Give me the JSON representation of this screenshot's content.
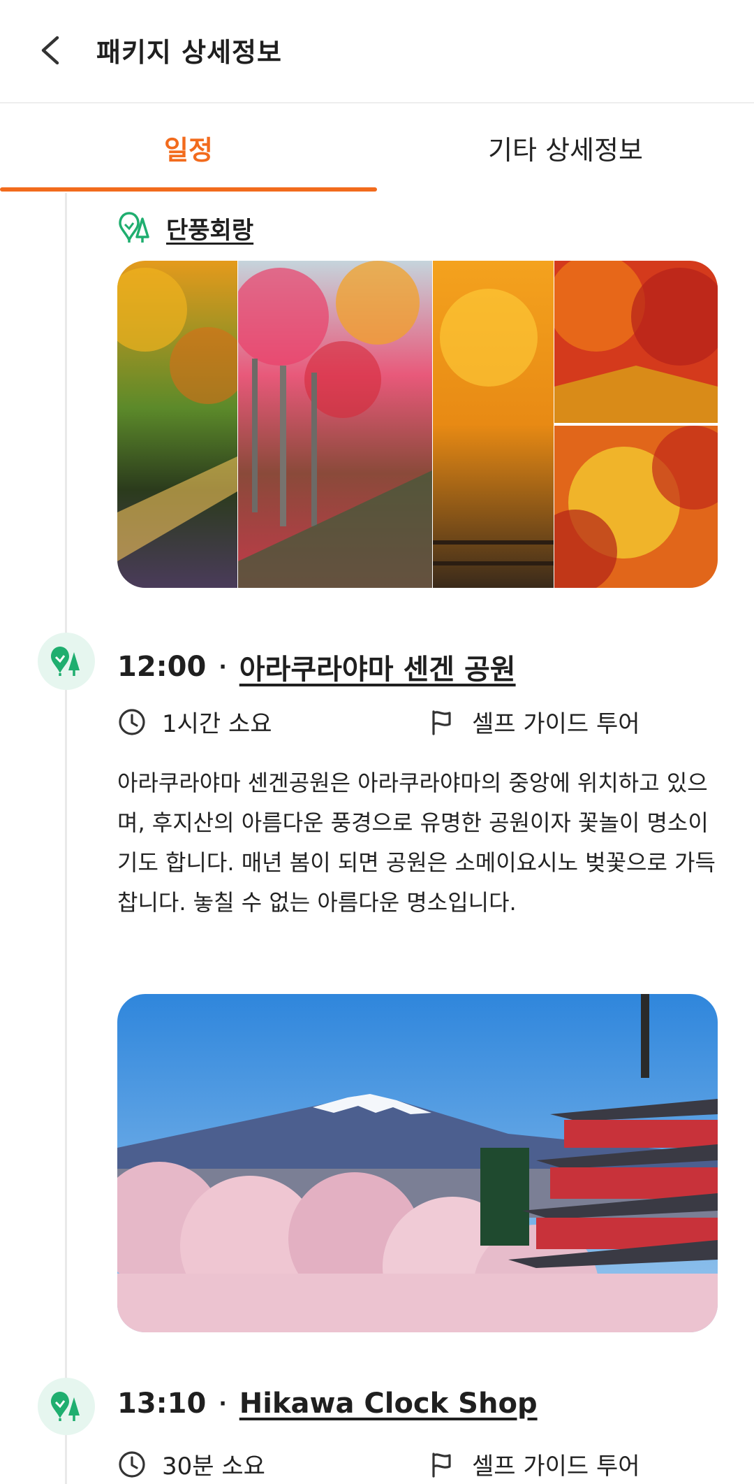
{
  "header": {
    "title": "패키지 상세정보",
    "back_icon": "chevron-left-icon"
  },
  "tabs": [
    {
      "label": "일정",
      "active": true
    },
    {
      "label": "기타 상세정보",
      "active": false
    }
  ],
  "colors": {
    "accent": "#f26b1d",
    "green": "#1fae6f",
    "green_bg": "#e6f6ef"
  },
  "itinerary": {
    "place_prev": {
      "name": "단풍회랑",
      "icon": "tree-location-icon"
    },
    "stops": [
      {
        "time": "12:00",
        "sep": "·",
        "name": "아라쿠라야마 센겐 공원",
        "duration": "1시간 소요",
        "guide": "셀프 가이드 투어",
        "description": "아라쿠라야마 센겐공원은 아라쿠라야마의 중앙에 위치하고 있으며, 후지산의 아름다운 풍경으로 유명한 공원이자 꽃놀이 명소이기도 합니다. 매년 봄이 되면 공원은 소메이요시노 벚꽃으로 가득 찹니다. 놓칠 수 없는 아름다운 명소입니다."
      },
      {
        "time": "13:10",
        "sep": "·",
        "name": "Hikawa Clock Shop",
        "duration": "30분 소요",
        "guide": "셀프 가이드 투어"
      }
    ]
  }
}
